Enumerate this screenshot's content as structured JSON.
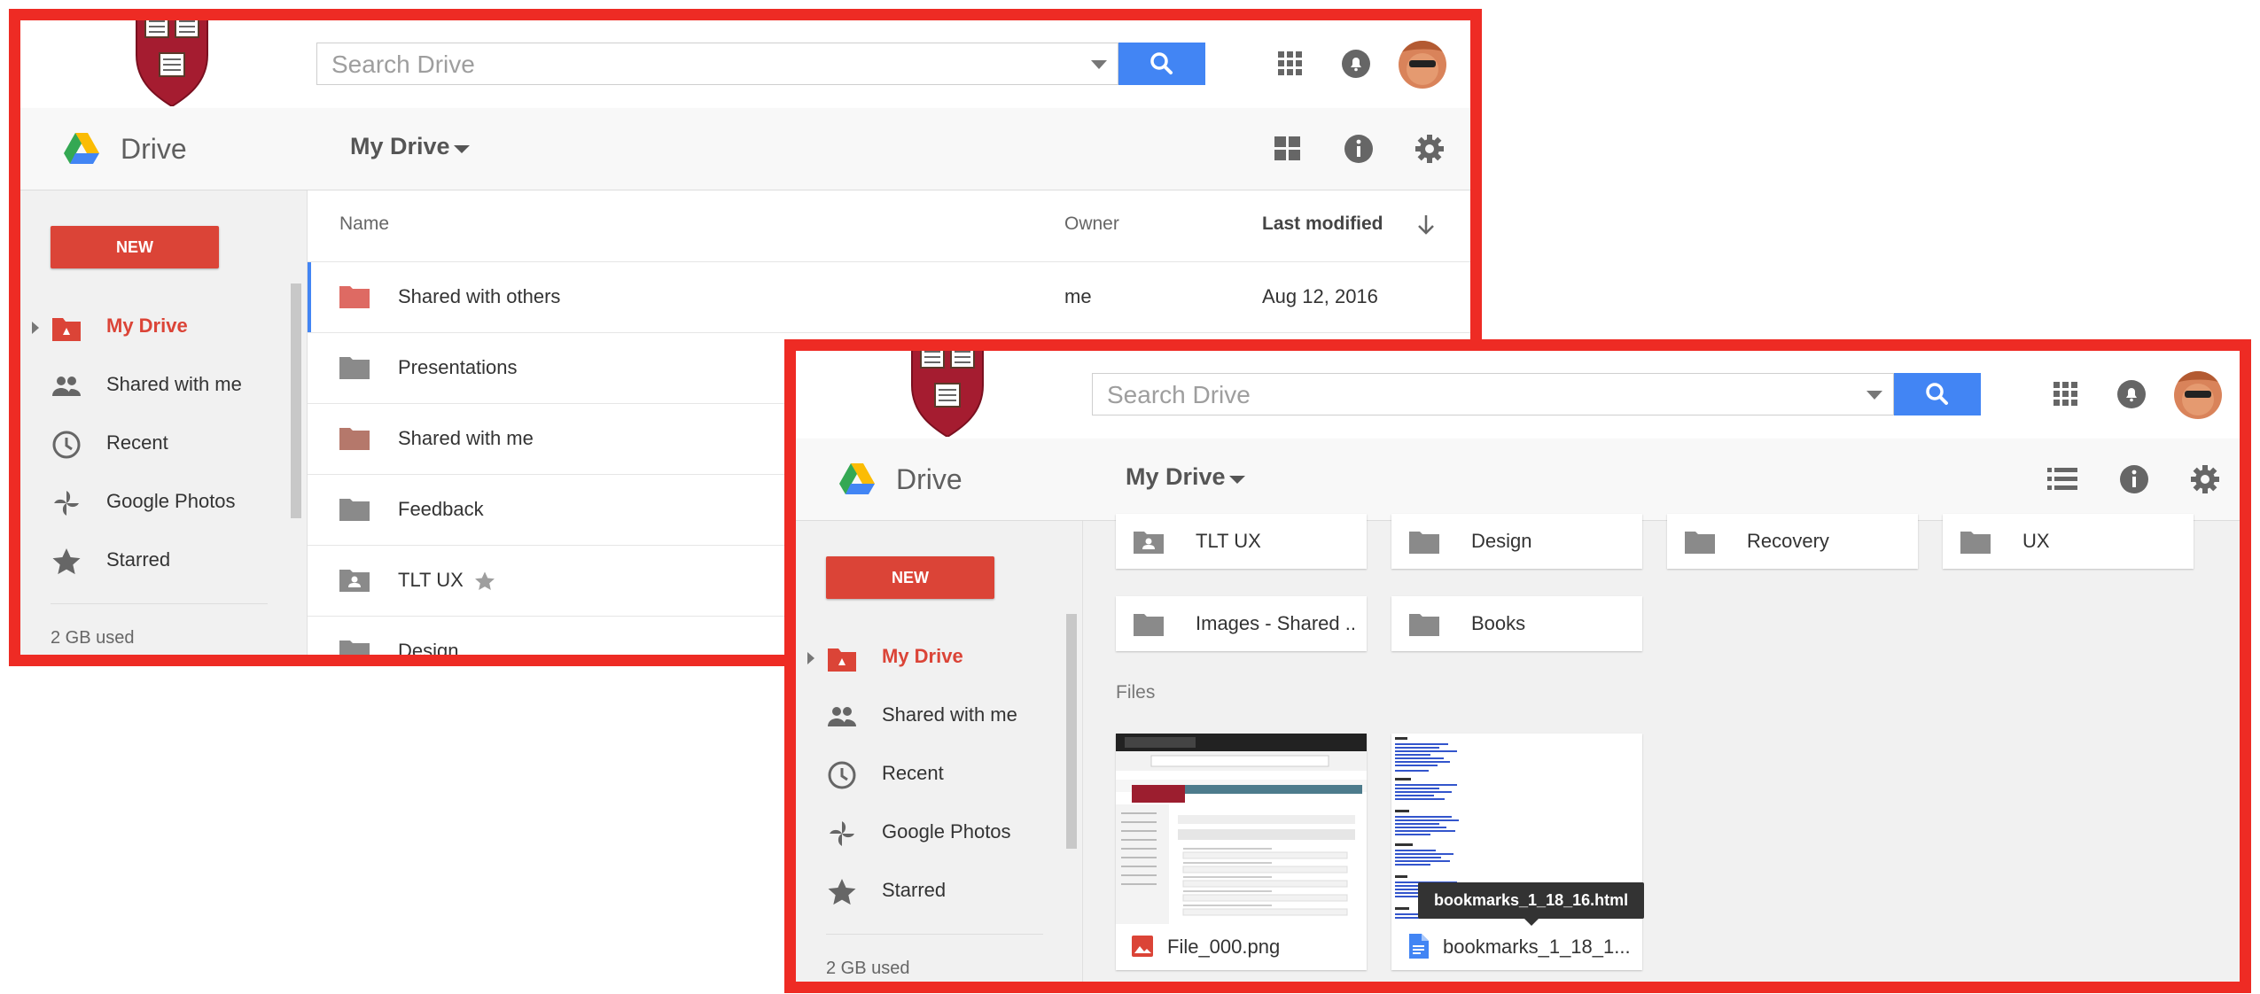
{
  "colors": {
    "frame": "#ee2b24",
    "accent_red": "#db4437",
    "search_blue": "#4285f4",
    "folder_gray": "#8a8a8a",
    "folder_red": "#de6a63",
    "folder_brown": "#b5786b"
  },
  "header": {
    "search_placeholder": "Search Drive",
    "app_title": "Drive",
    "location": "My Drive",
    "icons": [
      "apps-grid-icon",
      "notifications-icon",
      "account-avatar"
    ]
  },
  "sidebar": {
    "new_label": "NEW",
    "items": [
      {
        "label": "My Drive",
        "icon": "my-drive-icon",
        "active": true
      },
      {
        "label": "Shared with me",
        "icon": "people-icon"
      },
      {
        "label": "Recent",
        "icon": "clock-icon"
      },
      {
        "label": "Google Photos",
        "icon": "pinwheel-icon"
      },
      {
        "label": "Starred",
        "icon": "star-icon"
      }
    ],
    "storage": "2 GB used"
  },
  "list_view": {
    "columns": {
      "name": "Name",
      "owner": "Owner",
      "modified": "Last modified"
    },
    "rows": [
      {
        "name": "Shared with others",
        "owner": "me",
        "modified": "Aug 12, 2016",
        "icon": "folder-red"
      },
      {
        "name": "Presentations",
        "owner": "",
        "modified": "",
        "icon": "folder-gray"
      },
      {
        "name": "Shared with me",
        "owner": "",
        "modified": "",
        "icon": "folder-brown"
      },
      {
        "name": "Feedback",
        "owner": "",
        "modified": "",
        "icon": "folder-gray"
      },
      {
        "name": "TLT UX",
        "owner": "",
        "modified": "",
        "icon": "shared-folder",
        "starred": true
      },
      {
        "name": "Design",
        "owner": "",
        "modified": "",
        "icon": "folder-gray"
      }
    ]
  },
  "grid_view": {
    "folders": [
      {
        "name": "TLT UX",
        "icon": "shared-folder"
      },
      {
        "name": "Design",
        "icon": "folder"
      },
      {
        "name": "Recovery",
        "icon": "folder"
      },
      {
        "name": "UX",
        "icon": "folder"
      },
      {
        "name": "Images - Shared ...",
        "icon": "folder"
      },
      {
        "name": "Books",
        "icon": "folder"
      }
    ],
    "files_label": "Files",
    "files": [
      {
        "name": "File_000.png",
        "icon": "image-file-icon"
      },
      {
        "name": "bookmarks_1_18_1...",
        "icon": "doc-file-icon"
      }
    ],
    "tooltip": "bookmarks_1_18_16.html"
  }
}
